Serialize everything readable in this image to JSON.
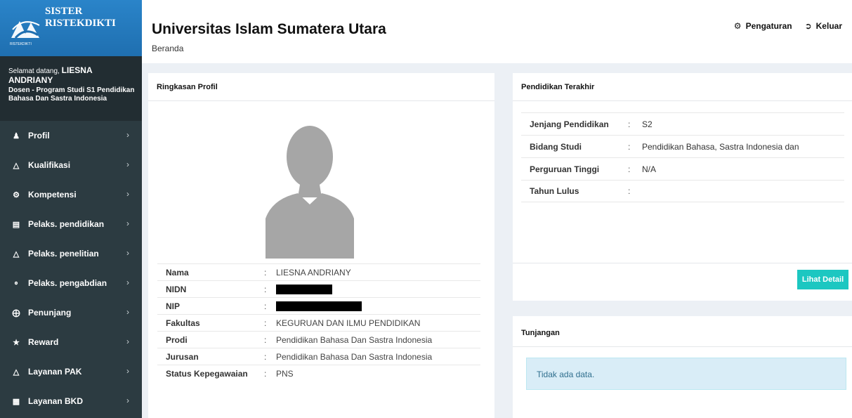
{
  "brand": {
    "line1": "SISTER",
    "line2": "RISTEKDIKTI",
    "logo_text": "RISTEKDIKTI"
  },
  "welcome": {
    "greeting": "Selamat datang,",
    "name": "LIESNA ANDRIANY",
    "role": "Dosen - Program Studi S1 Pendidikan Bahasa Dan Sastra Indonesia"
  },
  "menu": [
    {
      "label": "Profil",
      "icon": "user-icon"
    },
    {
      "label": "Kualifikasi",
      "icon": "graduation-cap-icon"
    },
    {
      "label": "Kompetensi",
      "icon": "cogs-icon"
    },
    {
      "label": "Pelaks. pendidikan",
      "icon": "book-icon"
    },
    {
      "label": "Pelaks. penelitian",
      "icon": "flask-icon"
    },
    {
      "label": "Pelaks. pengabdian",
      "icon": "share-icon"
    },
    {
      "label": "Penunjang",
      "icon": "life-ring-icon"
    },
    {
      "label": "Reward",
      "icon": "trophy-icon"
    },
    {
      "label": "Layanan PAK",
      "icon": "graduation-cap-icon"
    },
    {
      "label": "Layanan BKD",
      "icon": "briefcase-icon"
    }
  ],
  "header": {
    "title": "Universitas Islam Sumatera Utara",
    "breadcrumb": "Beranda",
    "settings_label": "Pengaturan",
    "logout_label": "Keluar"
  },
  "profile": {
    "title": "Ringkasan Profil",
    "rows": [
      {
        "key": "Nama",
        "value": "LIESNA ANDRIANY",
        "redacted": false
      },
      {
        "key": "NIDN",
        "value": "",
        "redacted": true
      },
      {
        "key": "NIP",
        "value": "",
        "redacted": true
      },
      {
        "key": "Fakultas",
        "value": "KEGURUAN DAN ILMU PENDIDIKAN",
        "redacted": false
      },
      {
        "key": "Prodi",
        "value": "Pendidikan Bahasa Dan Sastra Indonesia",
        "redacted": false
      },
      {
        "key": "Jurusan",
        "value": "Pendidikan Bahasa Dan Sastra Indonesia",
        "redacted": false
      },
      {
        "key": "Status Kepegawaian",
        "value": "PNS",
        "redacted": false
      }
    ]
  },
  "education": {
    "title": "Pendidikan Terakhir",
    "rows": [
      {
        "key": "Jenjang Pendidikan",
        "value": "S2"
      },
      {
        "key": "Bidang Studi",
        "value": "Pendidikan Bahasa, Sastra Indonesia dan"
      },
      {
        "key": "Perguruan Tinggi",
        "value": "N/A"
      },
      {
        "key": "Tahun Lulus",
        "value": ""
      }
    ],
    "detail_button": "Lihat Detail"
  },
  "tunjangan": {
    "title": "Tunjangan",
    "empty_text": "Tidak ada data."
  },
  "colors": {
    "sidebar": "#2c3b41",
    "brand": "#1f6fb0",
    "accent_button": "#1cc7c1",
    "alert_bg": "#d9edf7"
  }
}
